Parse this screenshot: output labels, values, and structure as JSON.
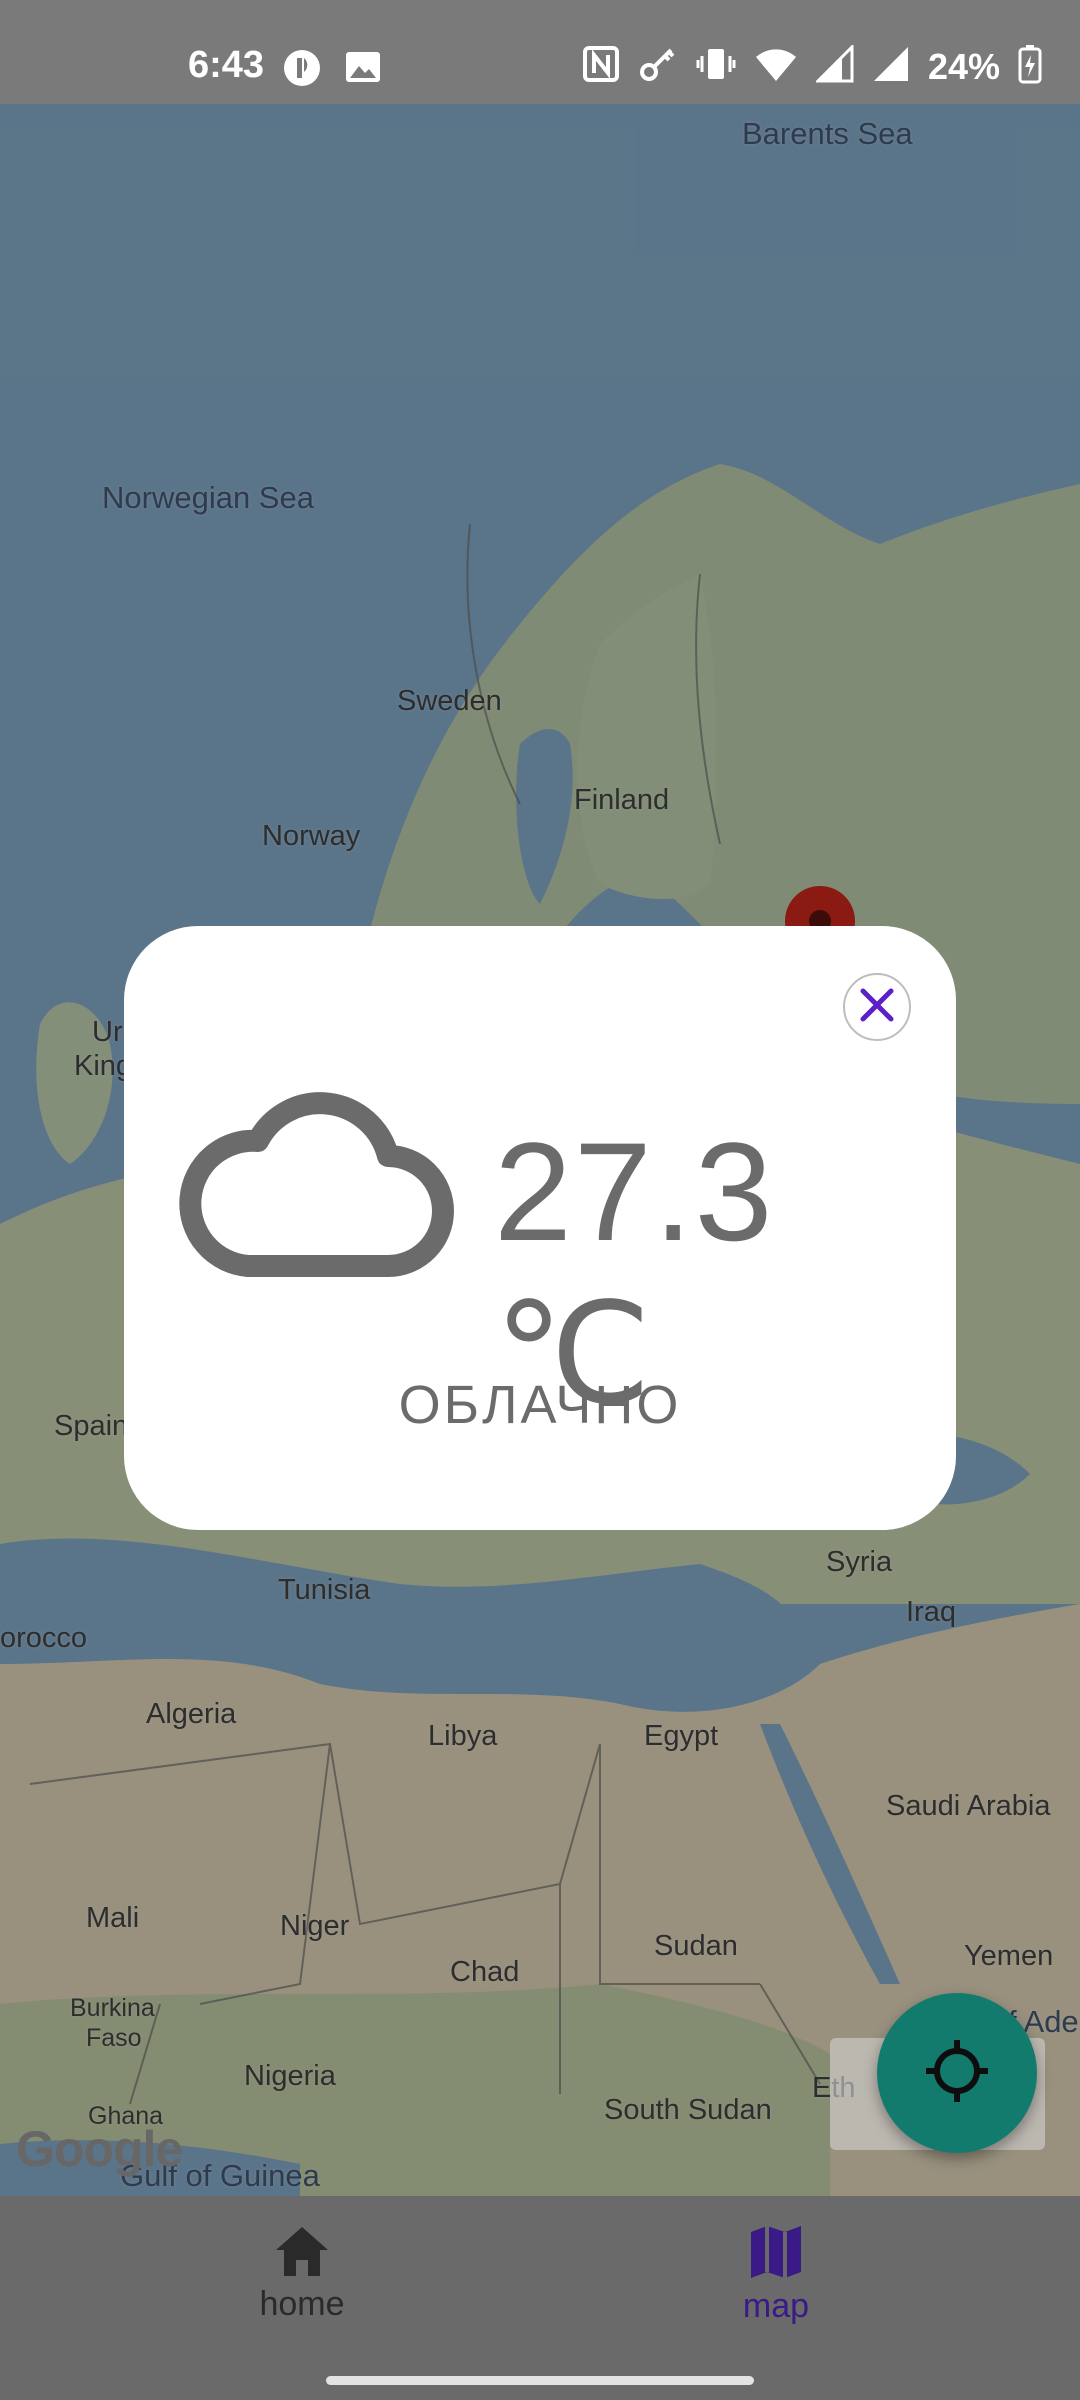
{
  "status_bar": {
    "time": "6:43",
    "battery_percent": "24%",
    "left_icons": [
      "notification-app-icon",
      "image-icon"
    ],
    "right_icons": [
      "nfc-icon",
      "key-icon",
      "vibrate-icon",
      "wifi-icon",
      "signal-icon",
      "signal-icon",
      "battery-charging-icon"
    ]
  },
  "map": {
    "labels": {
      "barents_sea": "Barents Sea",
      "norwegian_sea": "Norwegian Sea",
      "sweden": "Sweden",
      "finland": "Finland",
      "norway": "Norway",
      "uk_1": "Ur",
      "uk_2": "King",
      "spain": "Spain",
      "tunisia": "Tunisia",
      "syria": "Syria",
      "iraq": "Iraq",
      "morocco": "orocco",
      "algeria": "Algeria",
      "libya": "Libya",
      "egypt": "Egypt",
      "saudi_arabia": "Saudi Arabia",
      "mali": "Mali",
      "niger": "Niger",
      "chad": "Chad",
      "sudan": "Sudan",
      "yemen": "Yemen",
      "gulf_aden": "f Ade",
      "burkina_1": "Burkina",
      "burkina_2": "Faso",
      "nigeria": "Nigeria",
      "ghana": "Ghana",
      "south_sudan": "South Sudan",
      "ethiopia": "Eth",
      "gulf_guinea": "Gulf of Guinea"
    },
    "google_logo": "Google"
  },
  "weather_dialog": {
    "temperature": "27.3 ℃",
    "condition": "ОБЛАЧНО",
    "icon": "cloud-icon"
  },
  "bottom_nav": {
    "items": [
      {
        "label": "home",
        "icon": "home-icon",
        "active": false
      },
      {
        "label": "map",
        "icon": "map-icon",
        "active": true
      }
    ]
  },
  "colors": {
    "accent": "#5b20c7",
    "fab": "#137a6e",
    "dialog_text": "#6b6b6b"
  }
}
